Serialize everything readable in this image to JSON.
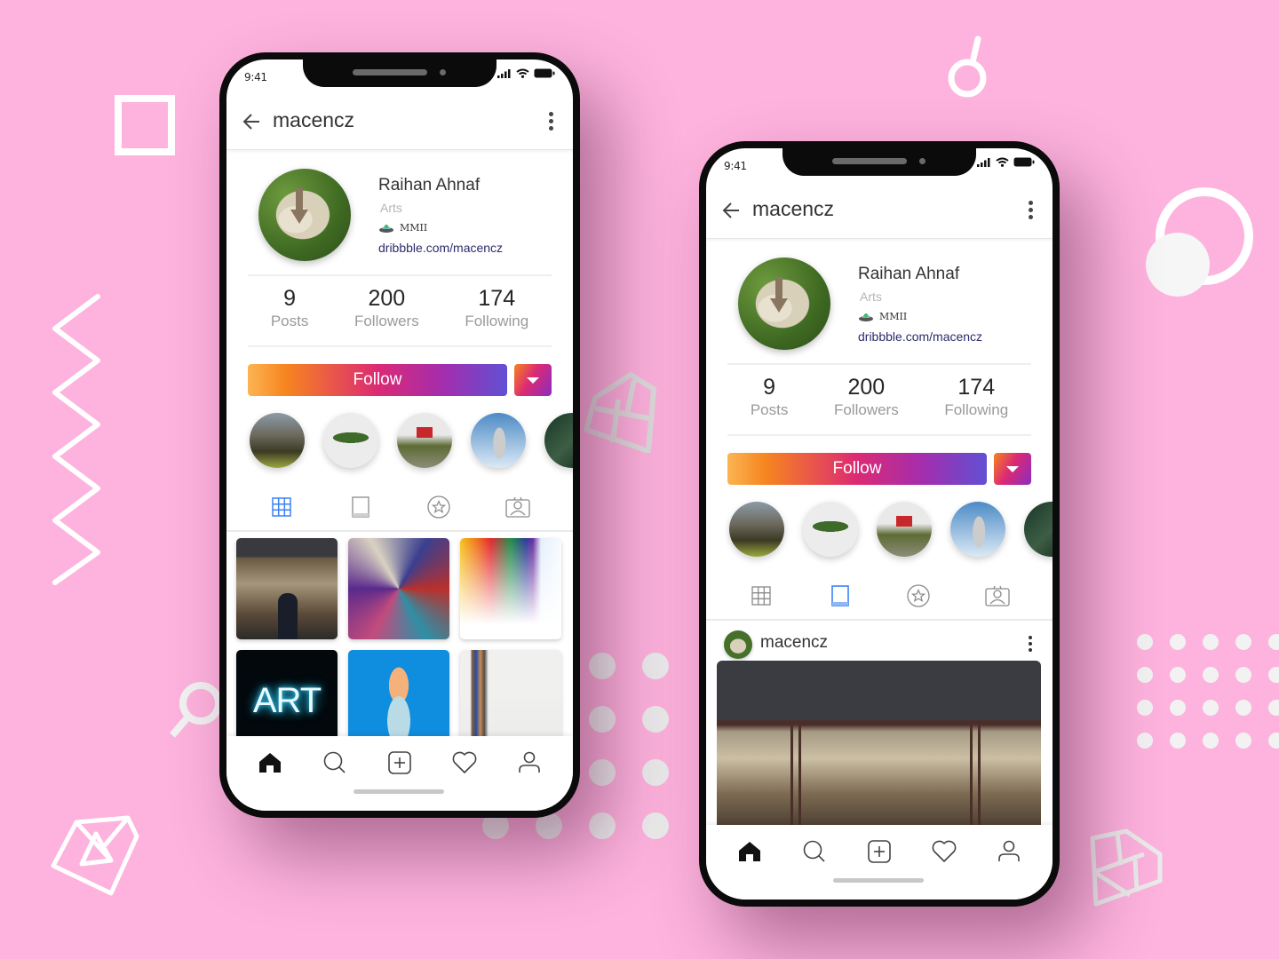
{
  "colors": {
    "background": "#fdb3dd",
    "accent_blue": "#3b82f6",
    "follow_gradient": [
      "#fbb552",
      "#f6841f",
      "#dc2a74",
      "#a42dad",
      "#6150d4"
    ],
    "link": "#2d2b6b"
  },
  "phones": [
    {
      "variant": "grid",
      "status": {
        "time": "9:41",
        "icons": [
          "signal-icon",
          "wifi-icon",
          "battery-icon"
        ]
      },
      "header": {
        "title": "macencz",
        "back_icon": "arrow-left-icon",
        "menu_icon": "kebab-menu-icon"
      },
      "profile": {
        "name": "Raihan Ahnaf",
        "category": "Arts",
        "bio_emoji": "ufo-icon",
        "bio": "MMII",
        "link": "dribbble.com/macencz"
      },
      "stats": [
        {
          "value": "9",
          "label": "Posts"
        },
        {
          "value": "200",
          "label": "Followers"
        },
        {
          "value": "174",
          "label": "Following"
        }
      ],
      "follow_label": "Follow",
      "highlights": [
        "mountain-valley",
        "leaf",
        "red-cabin",
        "robot-statue",
        "guitar-plant"
      ],
      "tabs": [
        {
          "name": "grid",
          "active": true
        },
        {
          "name": "feed",
          "active": false
        },
        {
          "name": "saved",
          "active": false
        },
        {
          "name": "tagged",
          "active": false
        }
      ],
      "grid_posts": [
        "gallery-painting",
        "paint-brushes",
        "rainbow-paint",
        "neon-art-sign",
        "pineapple",
        "brush-jar"
      ],
      "grid_text": {
        "neon_sign": "ART"
      },
      "nav": [
        "home",
        "search",
        "add",
        "activity",
        "profile"
      ]
    },
    {
      "variant": "feed",
      "status": {
        "time": "9:41",
        "icons": [
          "signal-icon",
          "wifi-icon",
          "battery-icon"
        ]
      },
      "header": {
        "title": "macencz",
        "back_icon": "arrow-left-icon",
        "menu_icon": "kebab-menu-icon"
      },
      "profile": {
        "name": "Raihan Ahnaf",
        "category": "Arts",
        "bio_emoji": "ufo-icon",
        "bio": "MMII",
        "link": "dribbble.com/macencz"
      },
      "stats": [
        {
          "value": "9",
          "label": "Posts"
        },
        {
          "value": "200",
          "label": "Followers"
        },
        {
          "value": "174",
          "label": "Following"
        }
      ],
      "follow_label": "Follow",
      "highlights": [
        "mountain-valley",
        "leaf",
        "red-cabin",
        "robot-statue",
        "guitar-plant"
      ],
      "tabs": [
        {
          "name": "grid",
          "active": false
        },
        {
          "name": "feed",
          "active": true
        },
        {
          "name": "saved",
          "active": false
        },
        {
          "name": "tagged",
          "active": false
        }
      ],
      "post": {
        "username": "macencz",
        "image": "gallery-painting"
      },
      "nav": [
        "home",
        "search",
        "add",
        "activity",
        "profile"
      ]
    }
  ]
}
